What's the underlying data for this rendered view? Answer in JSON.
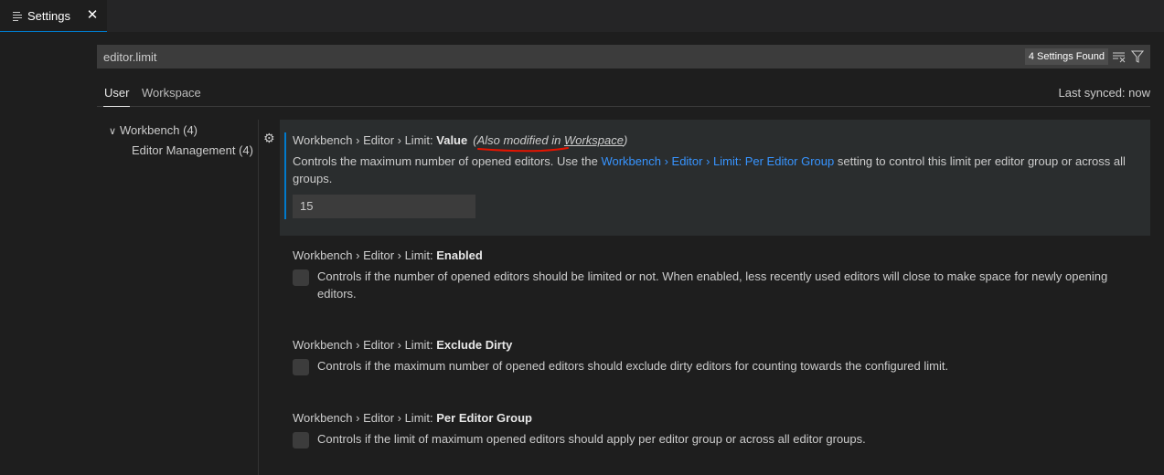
{
  "tab": {
    "label": "Settings",
    "close": "✕"
  },
  "search": {
    "value": "editor.limit",
    "count": "4 Settings Found"
  },
  "scope": {
    "user": "User",
    "workspace": "Workspace",
    "sync_status": "Last synced: now"
  },
  "toc": [
    {
      "label": "Workbench (4)",
      "expanded": true
    },
    {
      "label": "Editor Management (4)"
    }
  ],
  "settings": [
    {
      "category": "Workbench › Editor › Limit: ",
      "name": "Value",
      "modified_note_prefix": "(Also modified in ",
      "modified_note_link": "Workspace",
      "modified_note_suffix": ")",
      "desc_before": "Controls the maximum number of opened editors. Use the ",
      "desc_link": "Workbench › Editor › Limit: Per Editor Group",
      "desc_after": " setting to control this limit per editor group or across all groups.",
      "value": "15"
    },
    {
      "category": "Workbench › Editor › Limit: ",
      "name": "Enabled",
      "description": "Controls if the number of opened editors should be limited or not. When enabled, less recently used editors will close to make space for newly opening editors."
    },
    {
      "category": "Workbench › Editor › Limit: ",
      "name": "Exclude Dirty",
      "description": "Controls if the maximum number of opened editors should exclude dirty editors for counting towards the configured limit."
    },
    {
      "category": "Workbench › Editor › Limit: ",
      "name": "Per Editor Group",
      "description": "Controls if the limit of maximum opened editors should apply per editor group or across all editor groups."
    }
  ],
  "colors": {
    "accent": "#007acc",
    "link": "#3794ff",
    "annotation": "#e51400"
  }
}
